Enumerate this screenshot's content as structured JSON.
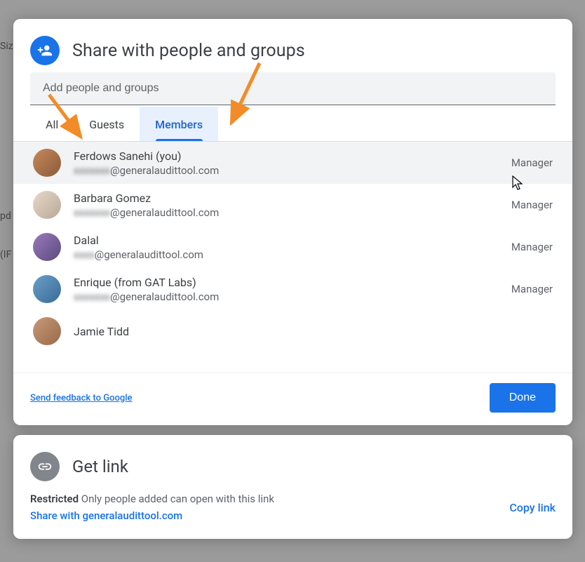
{
  "dialog": {
    "title": "Share with people and groups",
    "inputPlaceholder": "Add people and groups"
  },
  "tabs": {
    "all": "All",
    "guests": "Guests",
    "members": "Members"
  },
  "members": [
    {
      "name": "Ferdows Sanehi (you)",
      "emailSuffix": "@generalaudittool.com",
      "role": "Manager",
      "avatarColor": "#c78a5a"
    },
    {
      "name": "Barbara Gomez",
      "emailSuffix": "@generalaudittool.com",
      "role": "Manager",
      "avatarColor": "#d9c8b8"
    },
    {
      "name": "Dalal",
      "emailSuffix": "@generalaudittool.com",
      "role": "Manager",
      "avatarColor": "#7a6a9c"
    },
    {
      "name": "Enrique (from GAT Labs)",
      "emailSuffix": "@generalaudittool.com",
      "role": "Manager",
      "avatarColor": "#5a8fb8"
    },
    {
      "name": "Jamie Tidd",
      "emailSuffix": "",
      "role": "",
      "avatarColor": "#b87a5a"
    }
  ],
  "footer": {
    "feedback": "Send feedback to Google",
    "done": "Done"
  },
  "getLink": {
    "title": "Get link",
    "restrictedLabel": "Restricted",
    "restrictedDesc": " Only people added can open with this link",
    "shareOrg": "Share with generalaudittool.com",
    "copy": "Copy link"
  }
}
